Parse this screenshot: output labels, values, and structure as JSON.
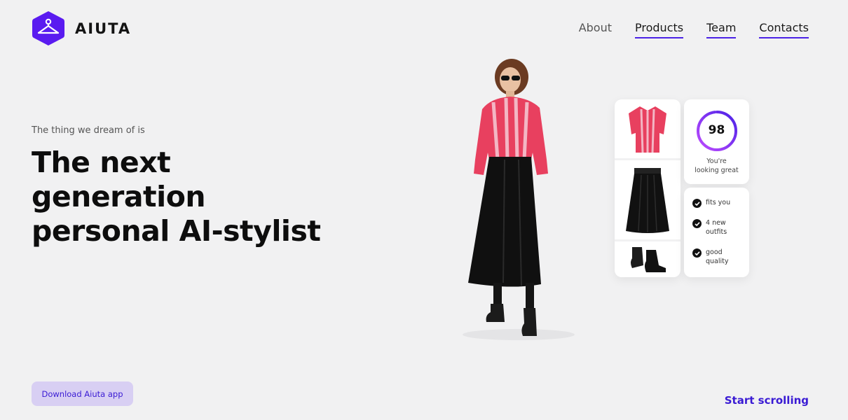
{
  "logo": {
    "name": "AIUTA"
  },
  "nav": {
    "items": [
      {
        "label": "About"
      },
      {
        "label": "Products"
      },
      {
        "label": "Team"
      },
      {
        "label": "Contacts"
      }
    ]
  },
  "hero": {
    "eyebrow": "The thing we dream of is",
    "headline_line1": "The next",
    "headline_line2": "generation",
    "headline_line3": "personal AI-stylist"
  },
  "outfit_card": {
    "items": [
      "shirt",
      "skirt",
      "boots"
    ]
  },
  "score_card": {
    "score": "98",
    "score_fraction": 0.98,
    "caption_line1": "You're",
    "caption_line2": "looking great"
  },
  "checks_card": {
    "checks": [
      {
        "line1": "fits you",
        "line2": ""
      },
      {
        "line1": "4 new",
        "line2": "outfits"
      },
      {
        "line1": "good",
        "line2": "quality"
      }
    ]
  },
  "cta": {
    "download_label": "Download Aiuta app"
  },
  "scroll": {
    "label": "Start scrolling"
  },
  "colors": {
    "accent": "#4a22e6",
    "button_bg": "#d8cff3",
    "shirt": "#e8405f"
  },
  "icons": {
    "logo": "hanger-icon",
    "check": "check-icon"
  }
}
